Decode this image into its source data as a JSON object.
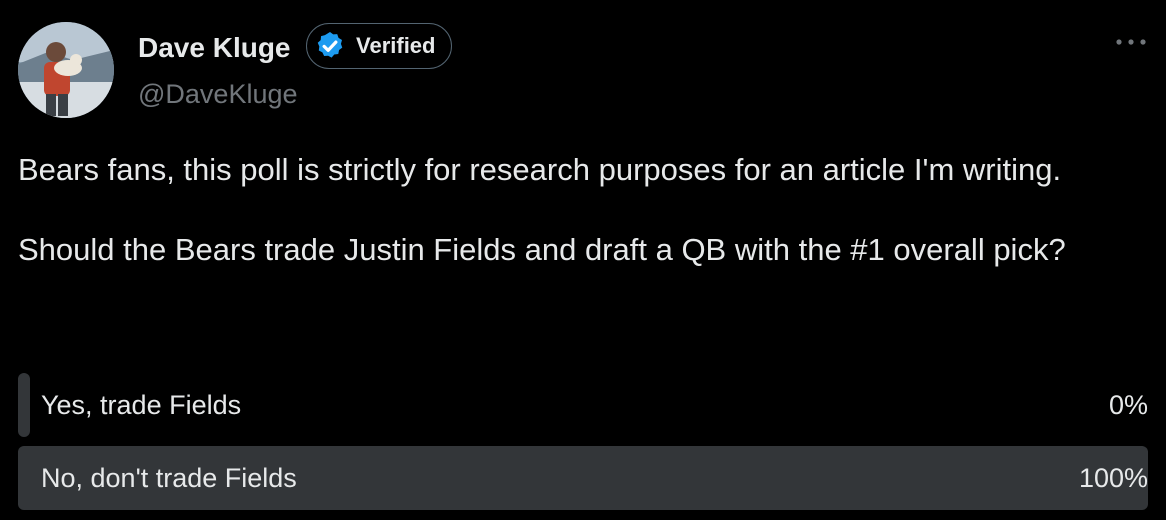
{
  "author": {
    "name": "Dave Kluge",
    "handle": "@DaveKluge",
    "verified_label": "Verified",
    "avatar_icon": "avatar-photo",
    "verified_icon": "verified-badge-icon"
  },
  "tweet": {
    "paragraphs": [
      "Bears fans, this poll is strictly for research purposes for an article I'm writing.",
      "Should the Bears trade Justin Fields and draft a QB with the #1 overall pick?"
    ]
  },
  "poll": {
    "options": [
      {
        "label": "Yes, trade Fields",
        "percent_text": "0%",
        "fraction": 0.0
      },
      {
        "label": "No, don't trade Fields",
        "percent_text": "100%",
        "fraction": 1.0
      }
    ]
  },
  "colors": {
    "background": "#000000",
    "text": "#e7e9ea",
    "muted": "#71767b",
    "poll_bar": "#333639",
    "verified_blue": "#1d9bf0",
    "chip_border": "#536471"
  },
  "icons": {
    "more": "more-options-icon"
  }
}
